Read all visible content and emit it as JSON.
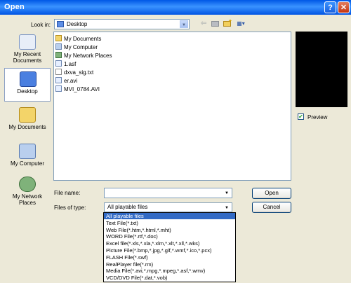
{
  "titlebar": {
    "title": "Open",
    "help_icon": "?",
    "close_icon": "✕"
  },
  "look_in": {
    "label": "Look in:",
    "value": "Desktop",
    "folder_icon": "desktop-icon"
  },
  "toolbar": {
    "back": "⇦",
    "up": "📁",
    "new_folder": "✦",
    "views": "▦▾"
  },
  "places": [
    {
      "label": "My Recent Documents",
      "icon": "recent-documents-icon"
    },
    {
      "label": "Desktop",
      "icon": "desktop-icon",
      "selected": true
    },
    {
      "label": "My Documents",
      "icon": "my-documents-icon"
    },
    {
      "label": "My Computer",
      "icon": "my-computer-icon"
    },
    {
      "label": "My Network Places",
      "icon": "network-places-icon"
    }
  ],
  "files": [
    {
      "name": "My Documents"
    },
    {
      "name": "My Computer"
    },
    {
      "name": "My Network Places"
    },
    {
      "name": "1.asf"
    },
    {
      "name": "dxva_sig.txt"
    },
    {
      "name": "er.avi"
    },
    {
      "name": "MVI_0784.AVI"
    }
  ],
  "preview": {
    "label": "Preview",
    "checked": true,
    "check_glyph": "✔"
  },
  "file_name": {
    "label": "File name:",
    "value": ""
  },
  "file_type": {
    "label": "Files of type:",
    "value": "All playable files"
  },
  "buttons": {
    "open": "Open",
    "cancel": "Cancel"
  },
  "type_options": [
    "All playable files",
    "Text File(*.txt)",
    "Web File(*.htm,*.html,*.mht)",
    "WORD File(*.rtf,*.doc)",
    "Excel file(*.xls,*.xla,*.xlm,*.xlt,*.xll,*.wks)",
    "Picture File(*.bmp,*.jpg,*.gif,*.wmf,*.ico,*.pcx)",
    "FLASH File(*.swf)",
    "RealPlayer file(*.rm)",
    "Media File(*.avi,*.mpg,*.mpeg,*.asf,*.wmv)",
    "VCD/DVD File(*.dat,*.vob)"
  ],
  "colors": {
    "title_bar": "#0058e6",
    "selection": "#316ac5",
    "dialog": "#ece9d8"
  }
}
